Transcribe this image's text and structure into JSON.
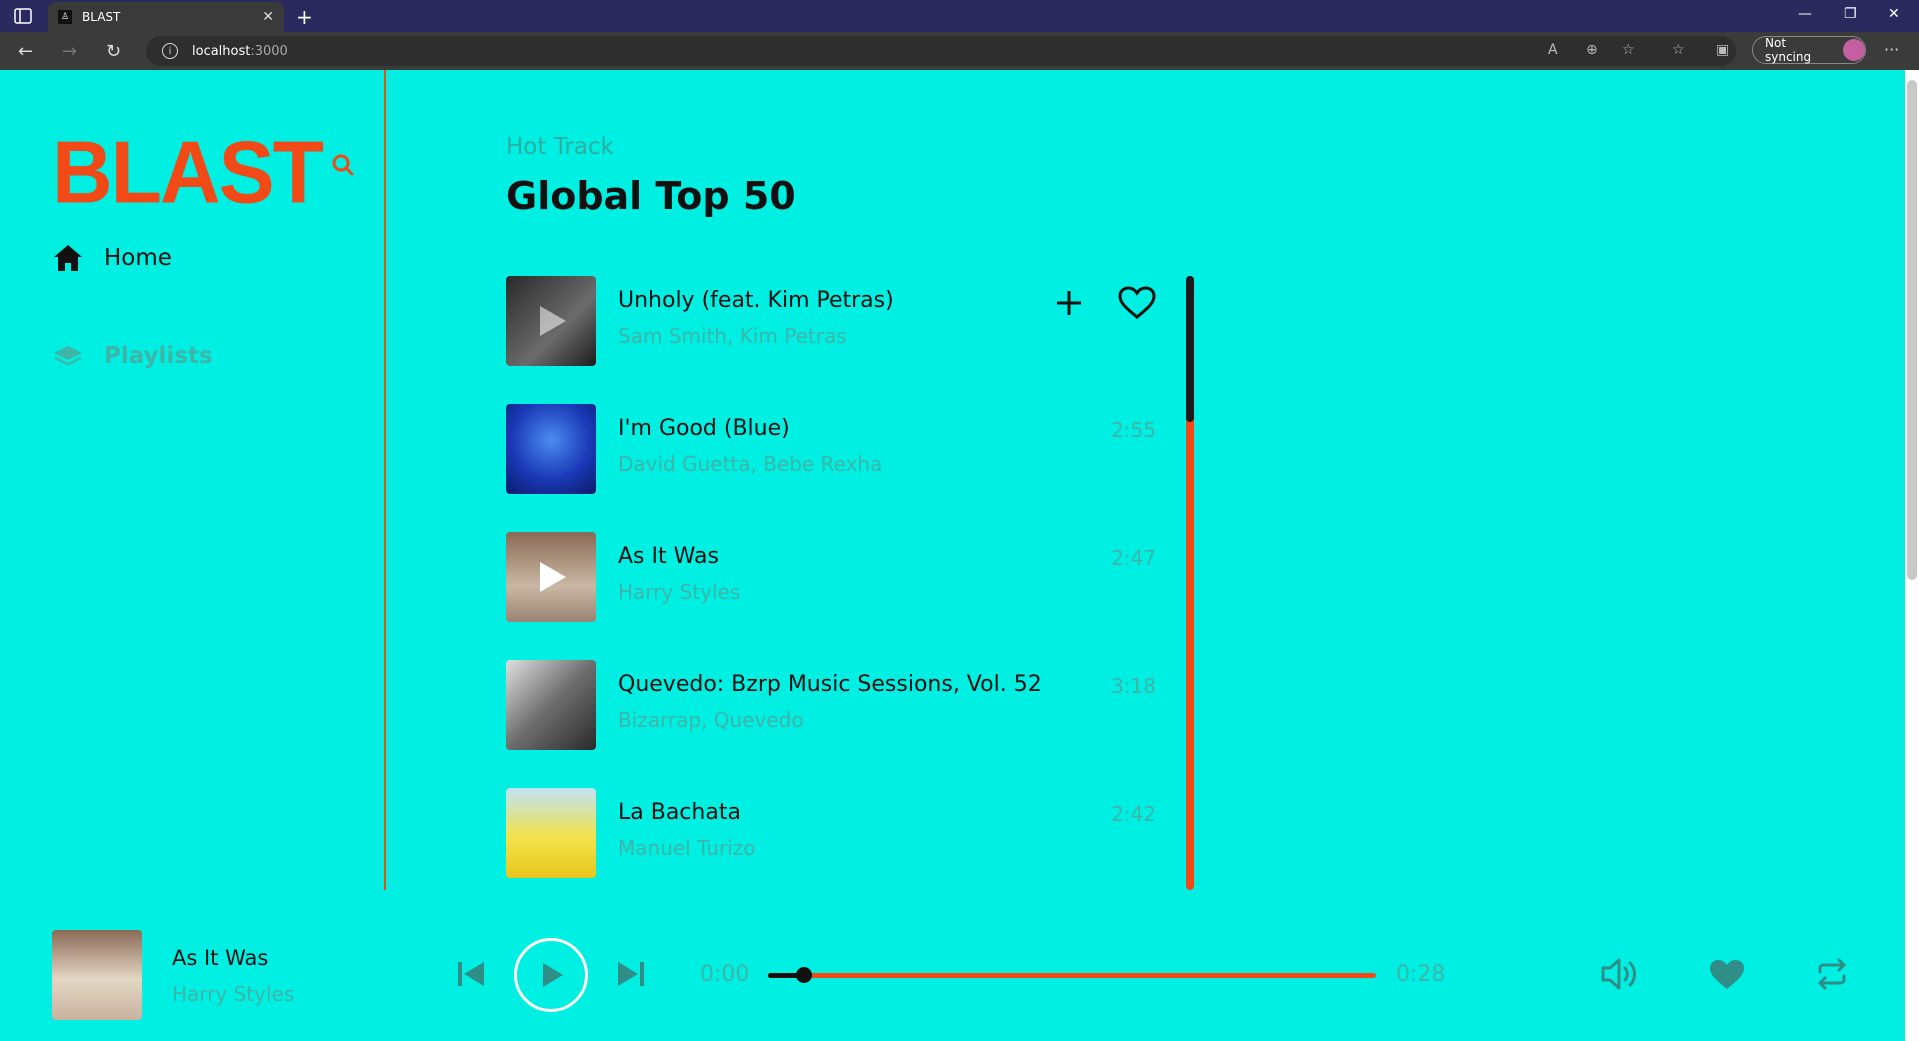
{
  "browser": {
    "tab_title": "BLAST",
    "url_host": "localhost",
    "url_port": ":3000",
    "sync_label": "Not syncing"
  },
  "sidebar": {
    "logo": "BLAST",
    "items": [
      {
        "label": "Home",
        "icon": "home-icon"
      },
      {
        "label": "Playlists",
        "icon": "layers-icon"
      }
    ]
  },
  "main": {
    "subtitle": "Hot Track",
    "title": "Global Top 50",
    "tracks": [
      {
        "title": "Unholy (feat. Kim Petras)",
        "artist": "Sam Smith, Kim Petras",
        "duration": ""
      },
      {
        "title": "I'm Good (Blue)",
        "artist": "David Guetta, Bebe Rexha",
        "duration": "2:55"
      },
      {
        "title": "As It Was",
        "artist": "Harry Styles",
        "duration": "2:47"
      },
      {
        "title": "Quevedo: Bzrp Music Sessions, Vol. 52",
        "artist": "Bizarrap, Quevedo",
        "duration": "3:18"
      },
      {
        "title": "La Bachata",
        "artist": "Manuel Turizo",
        "duration": "2:42"
      }
    ]
  },
  "player": {
    "title": "As It Was",
    "artist": "Harry Styles",
    "current_time": "0:00",
    "total_time": "0:28",
    "progress": 0.06
  },
  "colors": {
    "background": "#00efe3",
    "accent": "#f14a16",
    "muted_text": "#3fb5a8"
  }
}
